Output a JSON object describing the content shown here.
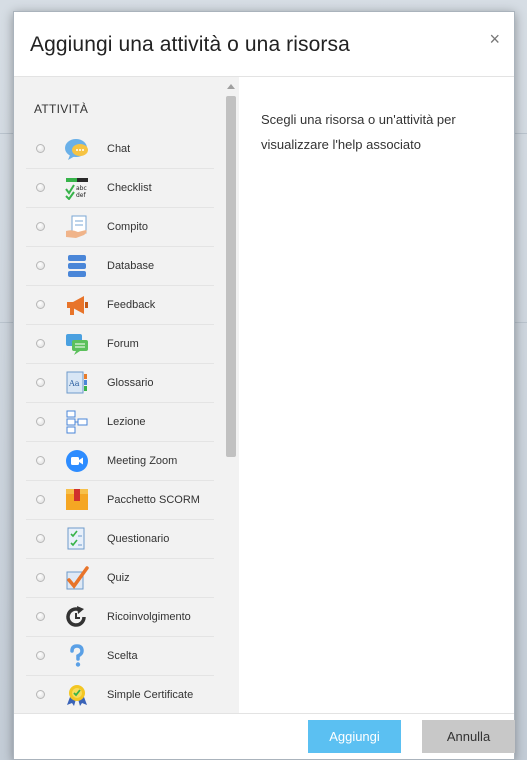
{
  "modal": {
    "title": "Aggiungi una attività o una risorsa",
    "close_glyph": "×",
    "section_title": "ATTIVITÀ",
    "help_text": "Scegli una risorsa o un'attività per visualizzare l'help associato"
  },
  "activities": [
    {
      "label": "Chat",
      "icon": "chat-icon"
    },
    {
      "label": "Checklist",
      "icon": "checklist-icon"
    },
    {
      "label": "Compito",
      "icon": "assignment-icon"
    },
    {
      "label": "Database",
      "icon": "database-icon"
    },
    {
      "label": "Feedback",
      "icon": "megaphone-icon"
    },
    {
      "label": "Forum",
      "icon": "forum-icon"
    },
    {
      "label": "Glossario",
      "icon": "glossary-icon"
    },
    {
      "label": "Lezione",
      "icon": "lesson-icon"
    },
    {
      "label": "Meeting Zoom",
      "icon": "zoom-camera-icon"
    },
    {
      "label": "Pacchetto SCORM",
      "icon": "scorm-package-icon"
    },
    {
      "label": "Questionario",
      "icon": "questionnaire-icon"
    },
    {
      "label": "Quiz",
      "icon": "quiz-icon"
    },
    {
      "label": "Ricoinvolgimento",
      "icon": "reengagement-icon"
    },
    {
      "label": "Scelta",
      "icon": "question-mark-icon"
    },
    {
      "label": "Simple Certificate",
      "icon": "certificate-icon"
    }
  ],
  "footer": {
    "add_label": "Aggiungi",
    "cancel_label": "Annulla"
  },
  "colors": {
    "primary_button": "#5bc0f2",
    "secondary_button": "#c8c8c8"
  }
}
